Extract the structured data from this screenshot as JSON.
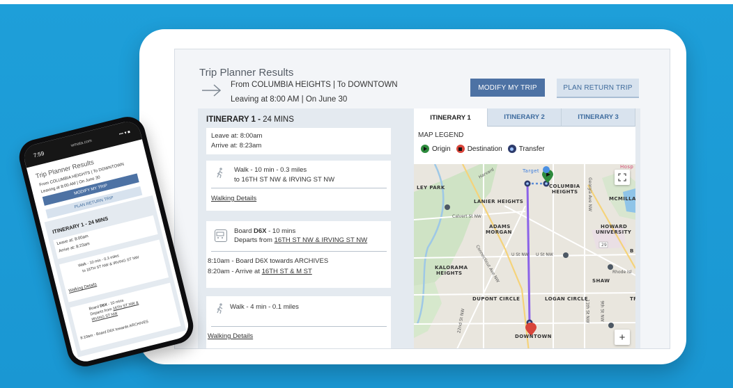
{
  "page": {
    "title": "Trip Planner Results",
    "route": "From COLUMBIA HEIGHTS  |  To DOWNTOWN",
    "leaving": "Leaving at 8:00 AM  |  On June 30",
    "modify_label": "MODIFY MY TRIP",
    "return_label": "PLAN RETURN TRIP"
  },
  "itinerary": {
    "title": "ITINERARY 1 - ",
    "duration": "24 MINS",
    "leave": "Leave at: 8:00am",
    "arrive": "Arrive at: 8:23am",
    "step1": {
      "text": "Walk - 10 min - 0.3 miles",
      "sub": "to 16TH ST NW & IRVING ST NW",
      "link": "Walking Details"
    },
    "step2": {
      "board_prefix": "Board ",
      "route": "D6X",
      "board_suffix": " - 10 mins",
      "departs_prefix": "Departs from ",
      "departs_stop": "16TH ST NW & IRVING ST NW",
      "line1": "8:10am - Board D6X towards ARCHIVES",
      "line2_prefix": "8:20am - Arrive at ",
      "line2_stop": "16TH ST & M ST"
    },
    "step3": {
      "text": "Walk - 4 min - 0.1 miles",
      "link": "Walking Details"
    }
  },
  "map_panel": {
    "tabs": [
      "ITINERARY 1",
      "ITINERARY 2",
      "ITINERARY 3"
    ],
    "legend_label": "MAP LEGEND",
    "legend": {
      "origin": "Origin",
      "destination": "Destination",
      "transfer": "Transfer"
    },
    "labels": {
      "target": "Target",
      "hosp": "Hosp",
      "columbia1": "COLUMBIA",
      "columbia2": "HEIGHTS",
      "ley_park": "LEY PARK",
      "lanier": "LANIER HEIGHTS",
      "mcmilla": "MCMILLA",
      "adams1": "ADAMS",
      "adams2": "MORGAN",
      "howard1": "HOWARD",
      "howard2": "UNIVERSITY",
      "kalorama1": "KALORAMA",
      "kalorama2": "HEIGHTS",
      "shaw": "SHAW",
      "dupont": "DUPONT CIRCLE",
      "logan": "LOGAN CIRCLE",
      "downtown": "DOWNTOWN",
      "tr": "TR",
      "b": "B"
    },
    "streets": {
      "calvert": "Calvert St NW",
      "ust1": "U St NW",
      "ust2": "U St NW",
      "rhode": "Rhode Isl",
      "conn": "Connecticut Ave NW",
      "s22": "22nd St NW",
      "s11": "11th St NW",
      "s9": "9th St NW",
      "harvard": "Harvard",
      "georgia": "Georgia Ave NW",
      "r29": "29"
    },
    "colors": {
      "route": "#8b62e8",
      "origin": "#2e8b3d",
      "destination": "#d8453a",
      "transfer": "#2d3b6b"
    }
  },
  "phone": {
    "time": "7:59",
    "url": "wmata.com",
    "signal": "••• ▾ ■",
    "title": "Trip Planner Results",
    "route": "From COLUMBIA HEIGHTS  |  To DOWNTOWN",
    "leaving": "Leaving at 8:00 AM  |  On June 30",
    "modify_label": "MODIFY MY TRIP",
    "return_label": "PLAN RETURN TRIP",
    "itin_title": "ITINERARY 1 - 24 MINS",
    "leave": "Leave at: 8:00am",
    "arrive": "Arrive at: 8:23am",
    "walk": "Walk - 10 min - 0.3 miles",
    "walk_sub": "to 16TH ST NW & IRVING ST NW",
    "walk_link": "Walking Details",
    "board_prefix": "Board ",
    "board_route": "D6X",
    "board_suffix": " - 10 mins",
    "departs_prefix": "Departs from ",
    "departs_stop1": "16TH ST NW &",
    "departs_stop2": "IRVING ST NW",
    "line1": "8:10am - Board D6X towards ARCHIVES"
  }
}
